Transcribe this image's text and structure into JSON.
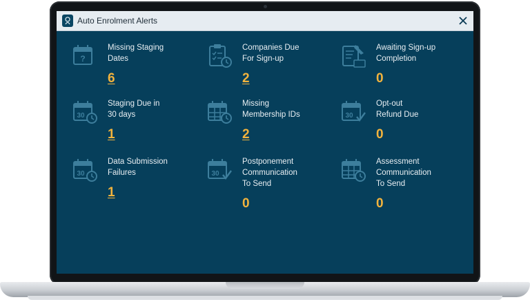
{
  "window": {
    "title": "Auto Enrolment Alerts",
    "close_glyph": "✕"
  },
  "alerts": [
    {
      "label_lines": [
        "Missing Staging",
        "Dates"
      ],
      "value": "6",
      "icon": "calendar-question-icon",
      "link": true
    },
    {
      "label_lines": [
        "Companies Due",
        "For Sign-up"
      ],
      "value": "2",
      "icon": "clipboard-clock-icon",
      "link": true
    },
    {
      "label_lines": [
        "Awaiting Sign-up",
        "Completion"
      ],
      "value": "0",
      "icon": "document-pen-icon",
      "link": false
    },
    {
      "label_lines": [
        "Staging Due in",
        "30 days"
      ],
      "value": "1",
      "icon": "calendar-30-clock-icon",
      "link": true
    },
    {
      "label_lines": [
        "Missing",
        "Membership IDs"
      ],
      "value": "2",
      "icon": "calendar-grid-clock-icon",
      "link": true
    },
    {
      "label_lines": [
        "Opt-out",
        "Refund Due"
      ],
      "value": "0",
      "icon": "calendar-30-check-icon",
      "link": false
    },
    {
      "label_lines": [
        "Data Submission",
        "Failures"
      ],
      "value": "1",
      "icon": "calendar-30-clock-icon",
      "link": true
    },
    {
      "label_lines": [
        "Postponement",
        "Communication",
        "To Send"
      ],
      "value": "0",
      "icon": "calendar-30-check-icon",
      "link": false
    },
    {
      "label_lines": [
        "Assessment",
        "Communication",
        "To Send"
      ],
      "value": "0",
      "icon": "calendar-grid-clock-icon",
      "link": false
    }
  ],
  "colors": {
    "panel": "#063f5b",
    "icon": "#3d7e9c",
    "value": "#f2b33d",
    "label": "#e8eef2"
  }
}
